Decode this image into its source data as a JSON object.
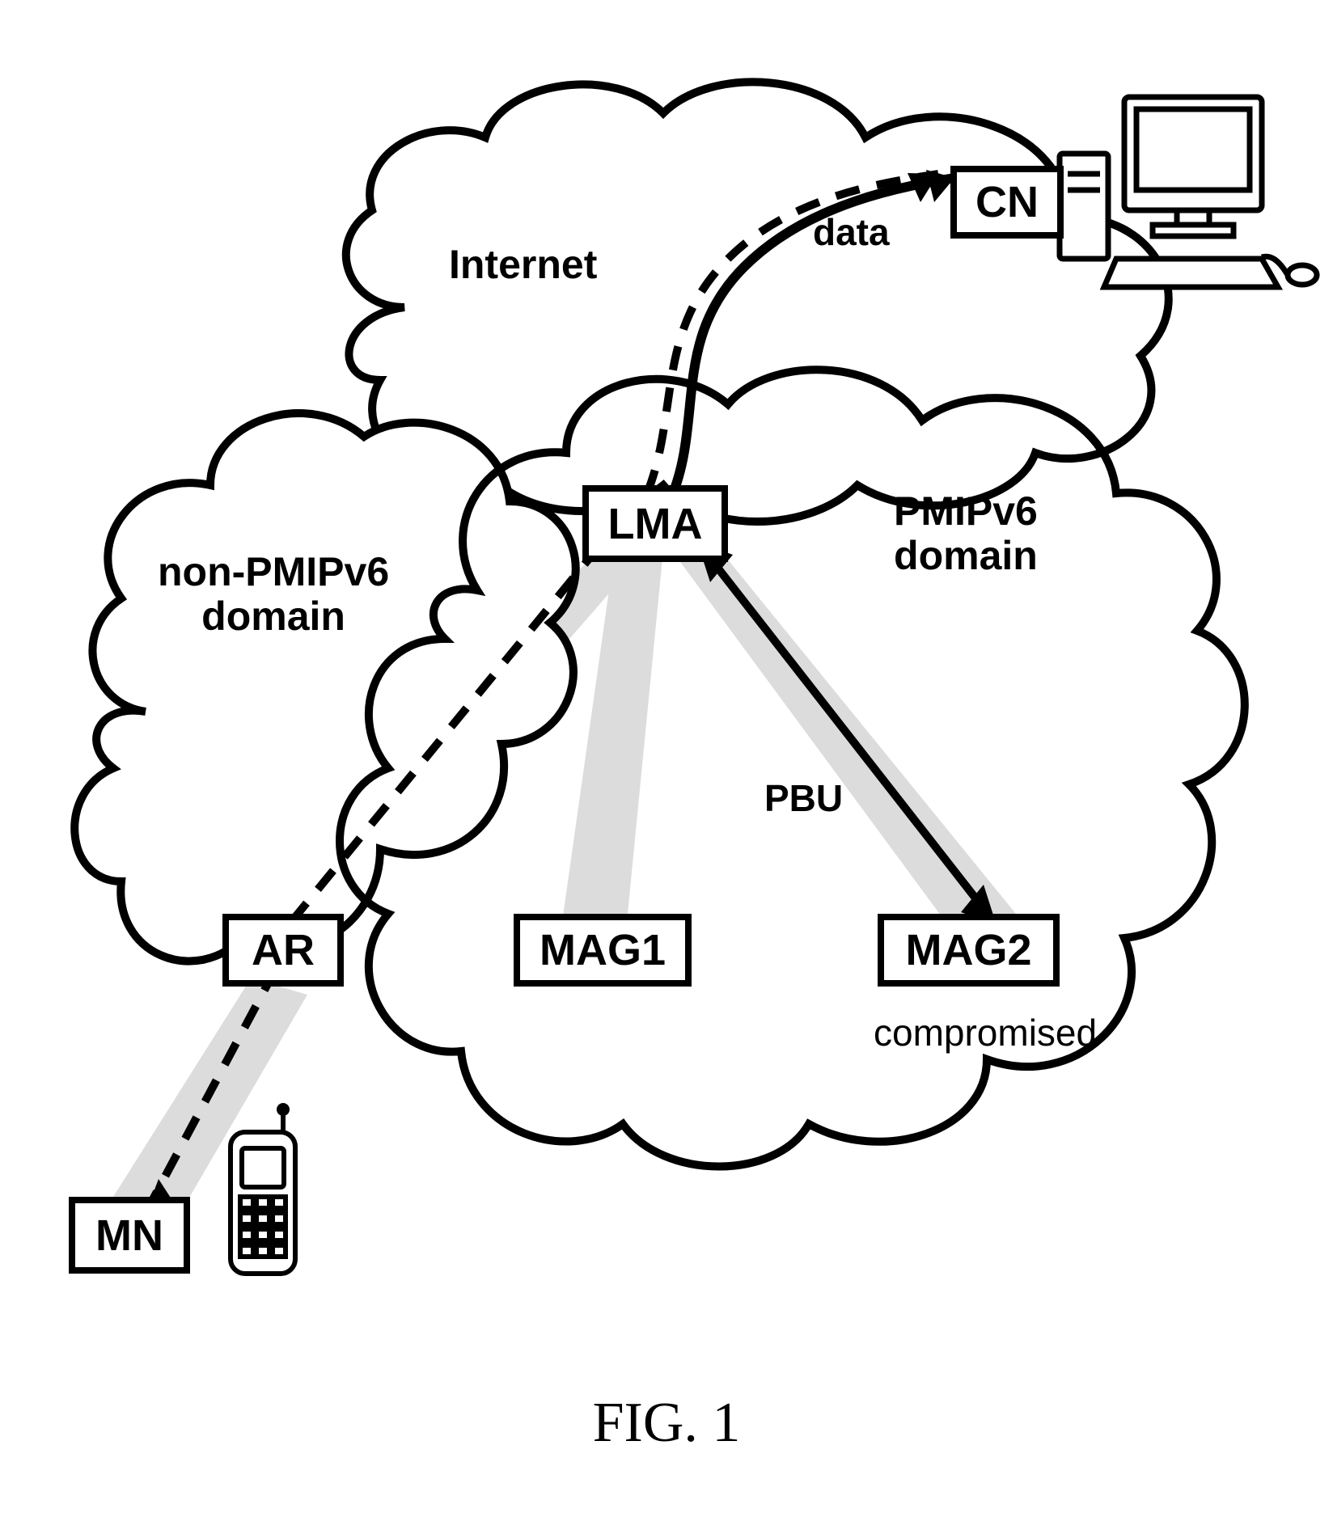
{
  "nodes": {
    "cn": "CN",
    "lma": "LMA",
    "ar": "AR",
    "mag1": "MAG1",
    "mag2": "MAG2",
    "mn": "MN"
  },
  "labels": {
    "internet": "Internet",
    "non_pmipv6": "non-PMIPv6\ndomain",
    "pmipv6": "PMIPv6\ndomain",
    "data": "data",
    "pbu": "PBU",
    "compromised": "compromised"
  },
  "caption": "FIG. 1"
}
